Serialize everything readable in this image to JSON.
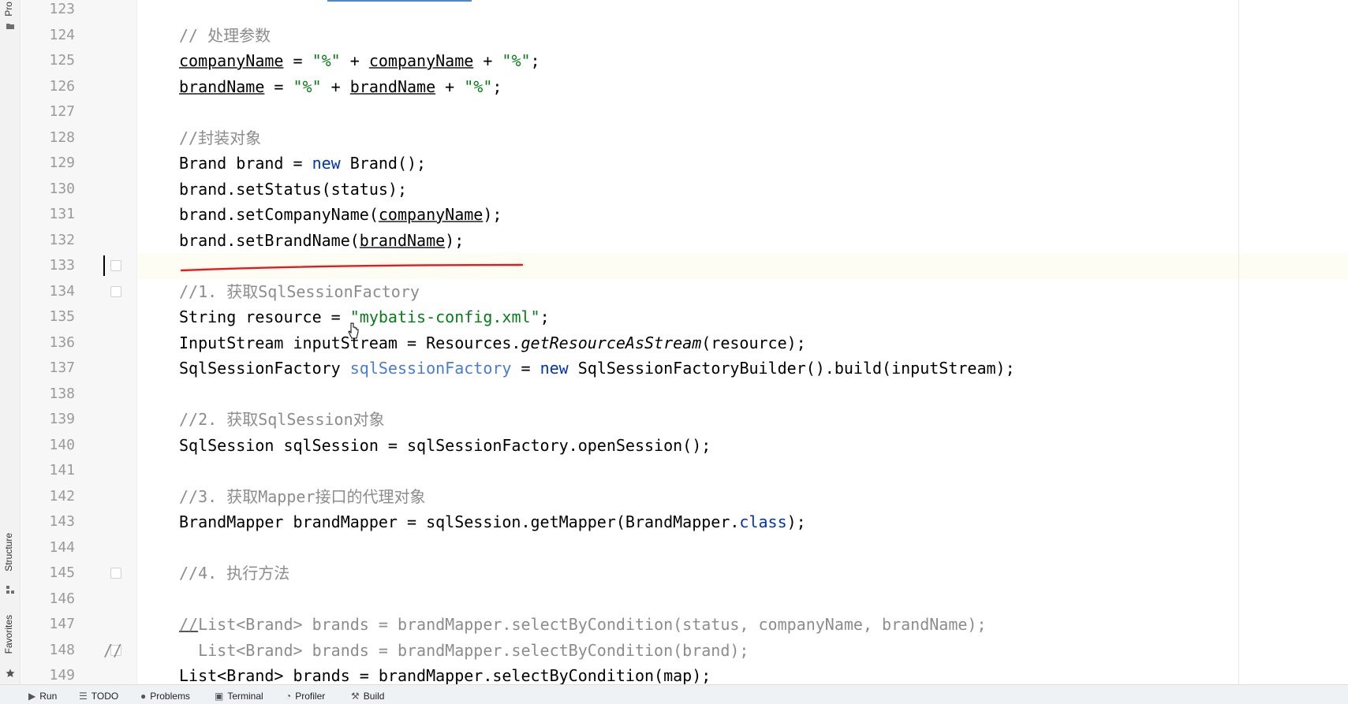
{
  "sidebar": {
    "project_label": "Pro",
    "structure_label": "Structure",
    "favorites_label": "Favorites"
  },
  "editor": {
    "lines": [
      {
        "num": "123",
        "html": ""
      },
      {
        "num": "124",
        "html": "<span class='cm'>// 处理参数</span>"
      },
      {
        "num": "125",
        "html": "<span class='ul'>companyName</span> = <span class='str'>\"%\"</span> + <span class='ul'>companyName</span> + <span class='str'>\"%\"</span>;"
      },
      {
        "num": "126",
        "html": "<span class='ul'>brandName</span> = <span class='str'>\"%\"</span> + <span class='ul'>brandName</span> + <span class='str'>\"%\"</span>;"
      },
      {
        "num": "127",
        "html": ""
      },
      {
        "num": "128",
        "html": "<span class='cm'>//封装对象</span>"
      },
      {
        "num": "129",
        "html": "Brand brand = <span class='kw'>new</span> Brand();"
      },
      {
        "num": "130",
        "html": "brand.setStatus(status);"
      },
      {
        "num": "131",
        "html": "brand.setCompanyName(<span class='ul'>companyName</span>);"
      },
      {
        "num": "132",
        "html": "brand.setBrandName(<span class='ul'>brandName</span>);"
      },
      {
        "num": "133",
        "html": ""
      },
      {
        "num": "134",
        "html": "<span class='cm'>//1. 获取SqlSessionFactory</span>"
      },
      {
        "num": "135",
        "html": "String resource = <span class='str'>\"mybatis-config.xml\"</span>;"
      },
      {
        "num": "136",
        "html": "InputStream inputStream = Resources.<span class='it'>getResourceAsStream</span>(resource);"
      },
      {
        "num": "137",
        "html": "SqlSessionFactory <span class='fld'>sqlSessionFactory</span> = <span class='kw'>new</span> SqlSessionFactoryBuilder().build(inputStream);"
      },
      {
        "num": "138",
        "html": ""
      },
      {
        "num": "139",
        "html": "<span class='cm'>//2. 获取SqlSession对象</span>"
      },
      {
        "num": "140",
        "html": "SqlSession sqlSession = sqlSessionFactory.openSession();"
      },
      {
        "num": "141",
        "html": ""
      },
      {
        "num": "142",
        "html": "<span class='cm'>//3. 获取Mapper接口的代理对象</span>"
      },
      {
        "num": "143",
        "html": "BrandMapper brandMapper = sqlSession.getMapper(BrandMapper.<span class='kw'>class</span>);"
      },
      {
        "num": "144",
        "html": ""
      },
      {
        "num": "145",
        "html": "<span class='cm'>//4. 执行方法</span>"
      },
      {
        "num": "146",
        "html": ""
      },
      {
        "num": "147",
        "html": "<span class='cm'><span class='ul'>//</span>List&lt;Brand&gt; brands = brandMapper.selectByCondition(status, companyName, brandName);</span>"
      },
      {
        "num": "148",
        "html": "<span class='cm'>  List&lt;Brand&gt; brands = brandMapper.selectByCondition(brand);</span>"
      },
      {
        "num": "149",
        "html": "List&lt;Brand&gt; brands = brandMapper.selectByCondition(map);"
      }
    ],
    "line148_prefix": "//"
  },
  "bottom_bar": {
    "tabs": [
      {
        "label": "Run",
        "icon": "run-icon"
      },
      {
        "label": "TODO",
        "icon": "todo-icon"
      },
      {
        "label": "Problems",
        "icon": "problems-icon"
      },
      {
        "label": "Terminal",
        "icon": "terminal-icon"
      },
      {
        "label": "Profiler",
        "icon": "profiler-icon"
      },
      {
        "label": "Build",
        "icon": "build-icon"
      }
    ]
  },
  "colors": {
    "keyword": "#0033b3",
    "string": "#067d17",
    "comment": "#8c8c8c",
    "field": "#4a7bd3",
    "annotation_stroke": "#e8191b"
  }
}
